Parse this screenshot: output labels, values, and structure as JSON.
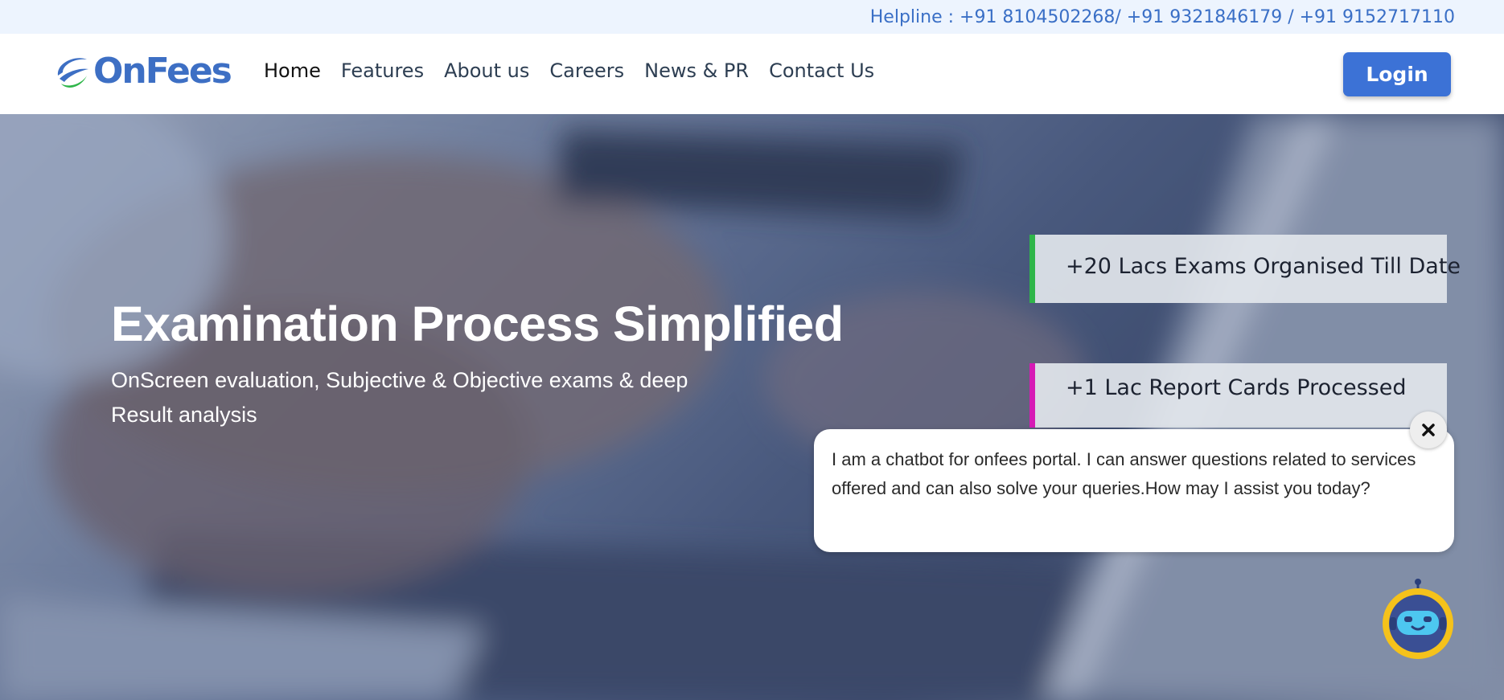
{
  "helpline": {
    "text": "Helpline : +91 8104502268/ +91 9321846179 / +91 9152717110"
  },
  "brand": {
    "name": "OnFees",
    "logo_icon": "onfees-swoosh-icon",
    "primary_color": "#3d6fc4",
    "accent_green": "#2fb64a"
  },
  "nav": {
    "items": [
      {
        "label": "Home",
        "active": true
      },
      {
        "label": "Features"
      },
      {
        "label": "About us"
      },
      {
        "label": "Careers"
      },
      {
        "label": "News & PR"
      },
      {
        "label": "Contact Us"
      }
    ],
    "login_label": "Login",
    "login_color": "#3c72d6"
  },
  "hero": {
    "title": "Examination Process Simplified",
    "subtitle": "OnScreen evaluation, Subjective & Objective exams & deep Result analysis",
    "stats": [
      {
        "text": "+20 Lacs Exams Organised Till Date",
        "accent": "#2fb64a"
      },
      {
        "text": "+1 Lac Report Cards Processed",
        "accent": "#d61ab5"
      }
    ]
  },
  "chatbot": {
    "message": "I am a chatbot for onfees portal. I can answer questions related to services offered and can also solve your queries.How may I assist you today?",
    "close_icon": "close-icon",
    "avatar_icon": "robot-icon"
  }
}
